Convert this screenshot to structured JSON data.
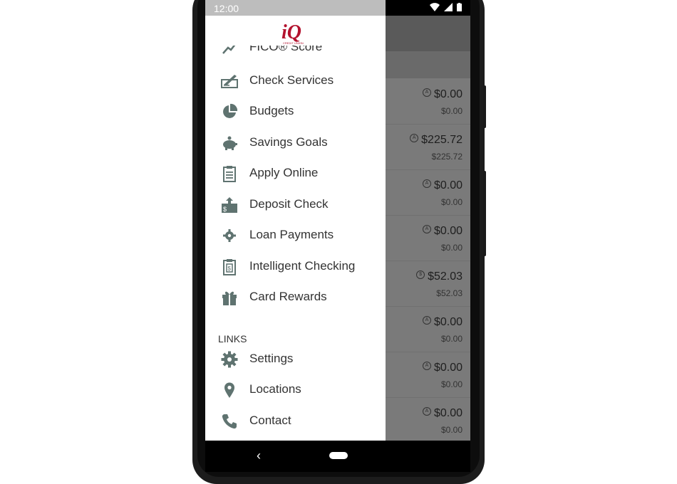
{
  "status_bar": {
    "time": "12:00"
  },
  "app": {
    "logo_text": "iQ",
    "logo_subtext": "CREDIT UNION"
  },
  "drawer": {
    "partial_item": "FICO® Score",
    "items": [
      {
        "label": "Check Services",
        "icon": "check-pen-icon"
      },
      {
        "label": "Budgets",
        "icon": "pie-chart-icon"
      },
      {
        "label": "Savings Goals",
        "icon": "piggy-bank-icon"
      },
      {
        "label": "Apply Online",
        "icon": "clipboard-icon"
      },
      {
        "label": "Deposit Check",
        "icon": "deposit-check-icon"
      },
      {
        "label": "Loan Payments",
        "icon": "gear-small-icon"
      },
      {
        "label": "Intelligent Checking",
        "icon": "clipboard-dollar-icon"
      },
      {
        "label": "Card Rewards",
        "icon": "gift-icon"
      }
    ],
    "links_section": "LINKS",
    "links": [
      {
        "label": "Settings",
        "icon": "gear-icon"
      },
      {
        "label": "Locations",
        "icon": "location-pin-icon"
      },
      {
        "label": "Contact",
        "icon": "phone-icon"
      }
    ]
  },
  "accounts": [
    {
      "balance": "$0.00",
      "available": "$0.00"
    },
    {
      "balance": "$225.72",
      "available": "$225.72"
    },
    {
      "balance": "$0.00",
      "available": "$0.00"
    },
    {
      "balance": "$0.00",
      "available": "$0.00"
    },
    {
      "balance": "$52.03",
      "available": "$52.03"
    },
    {
      "balance": "$0.00",
      "available": "$0.00"
    },
    {
      "balance": "$0.00",
      "available": "$0.00"
    },
    {
      "balance": "$0.00",
      "available": "$0.00"
    }
  ],
  "navbar": {
    "back_glyph": "‹"
  },
  "colors": {
    "icon": "#5f7370",
    "brand": "#b3122e",
    "scrim": "#7a7a7a"
  }
}
